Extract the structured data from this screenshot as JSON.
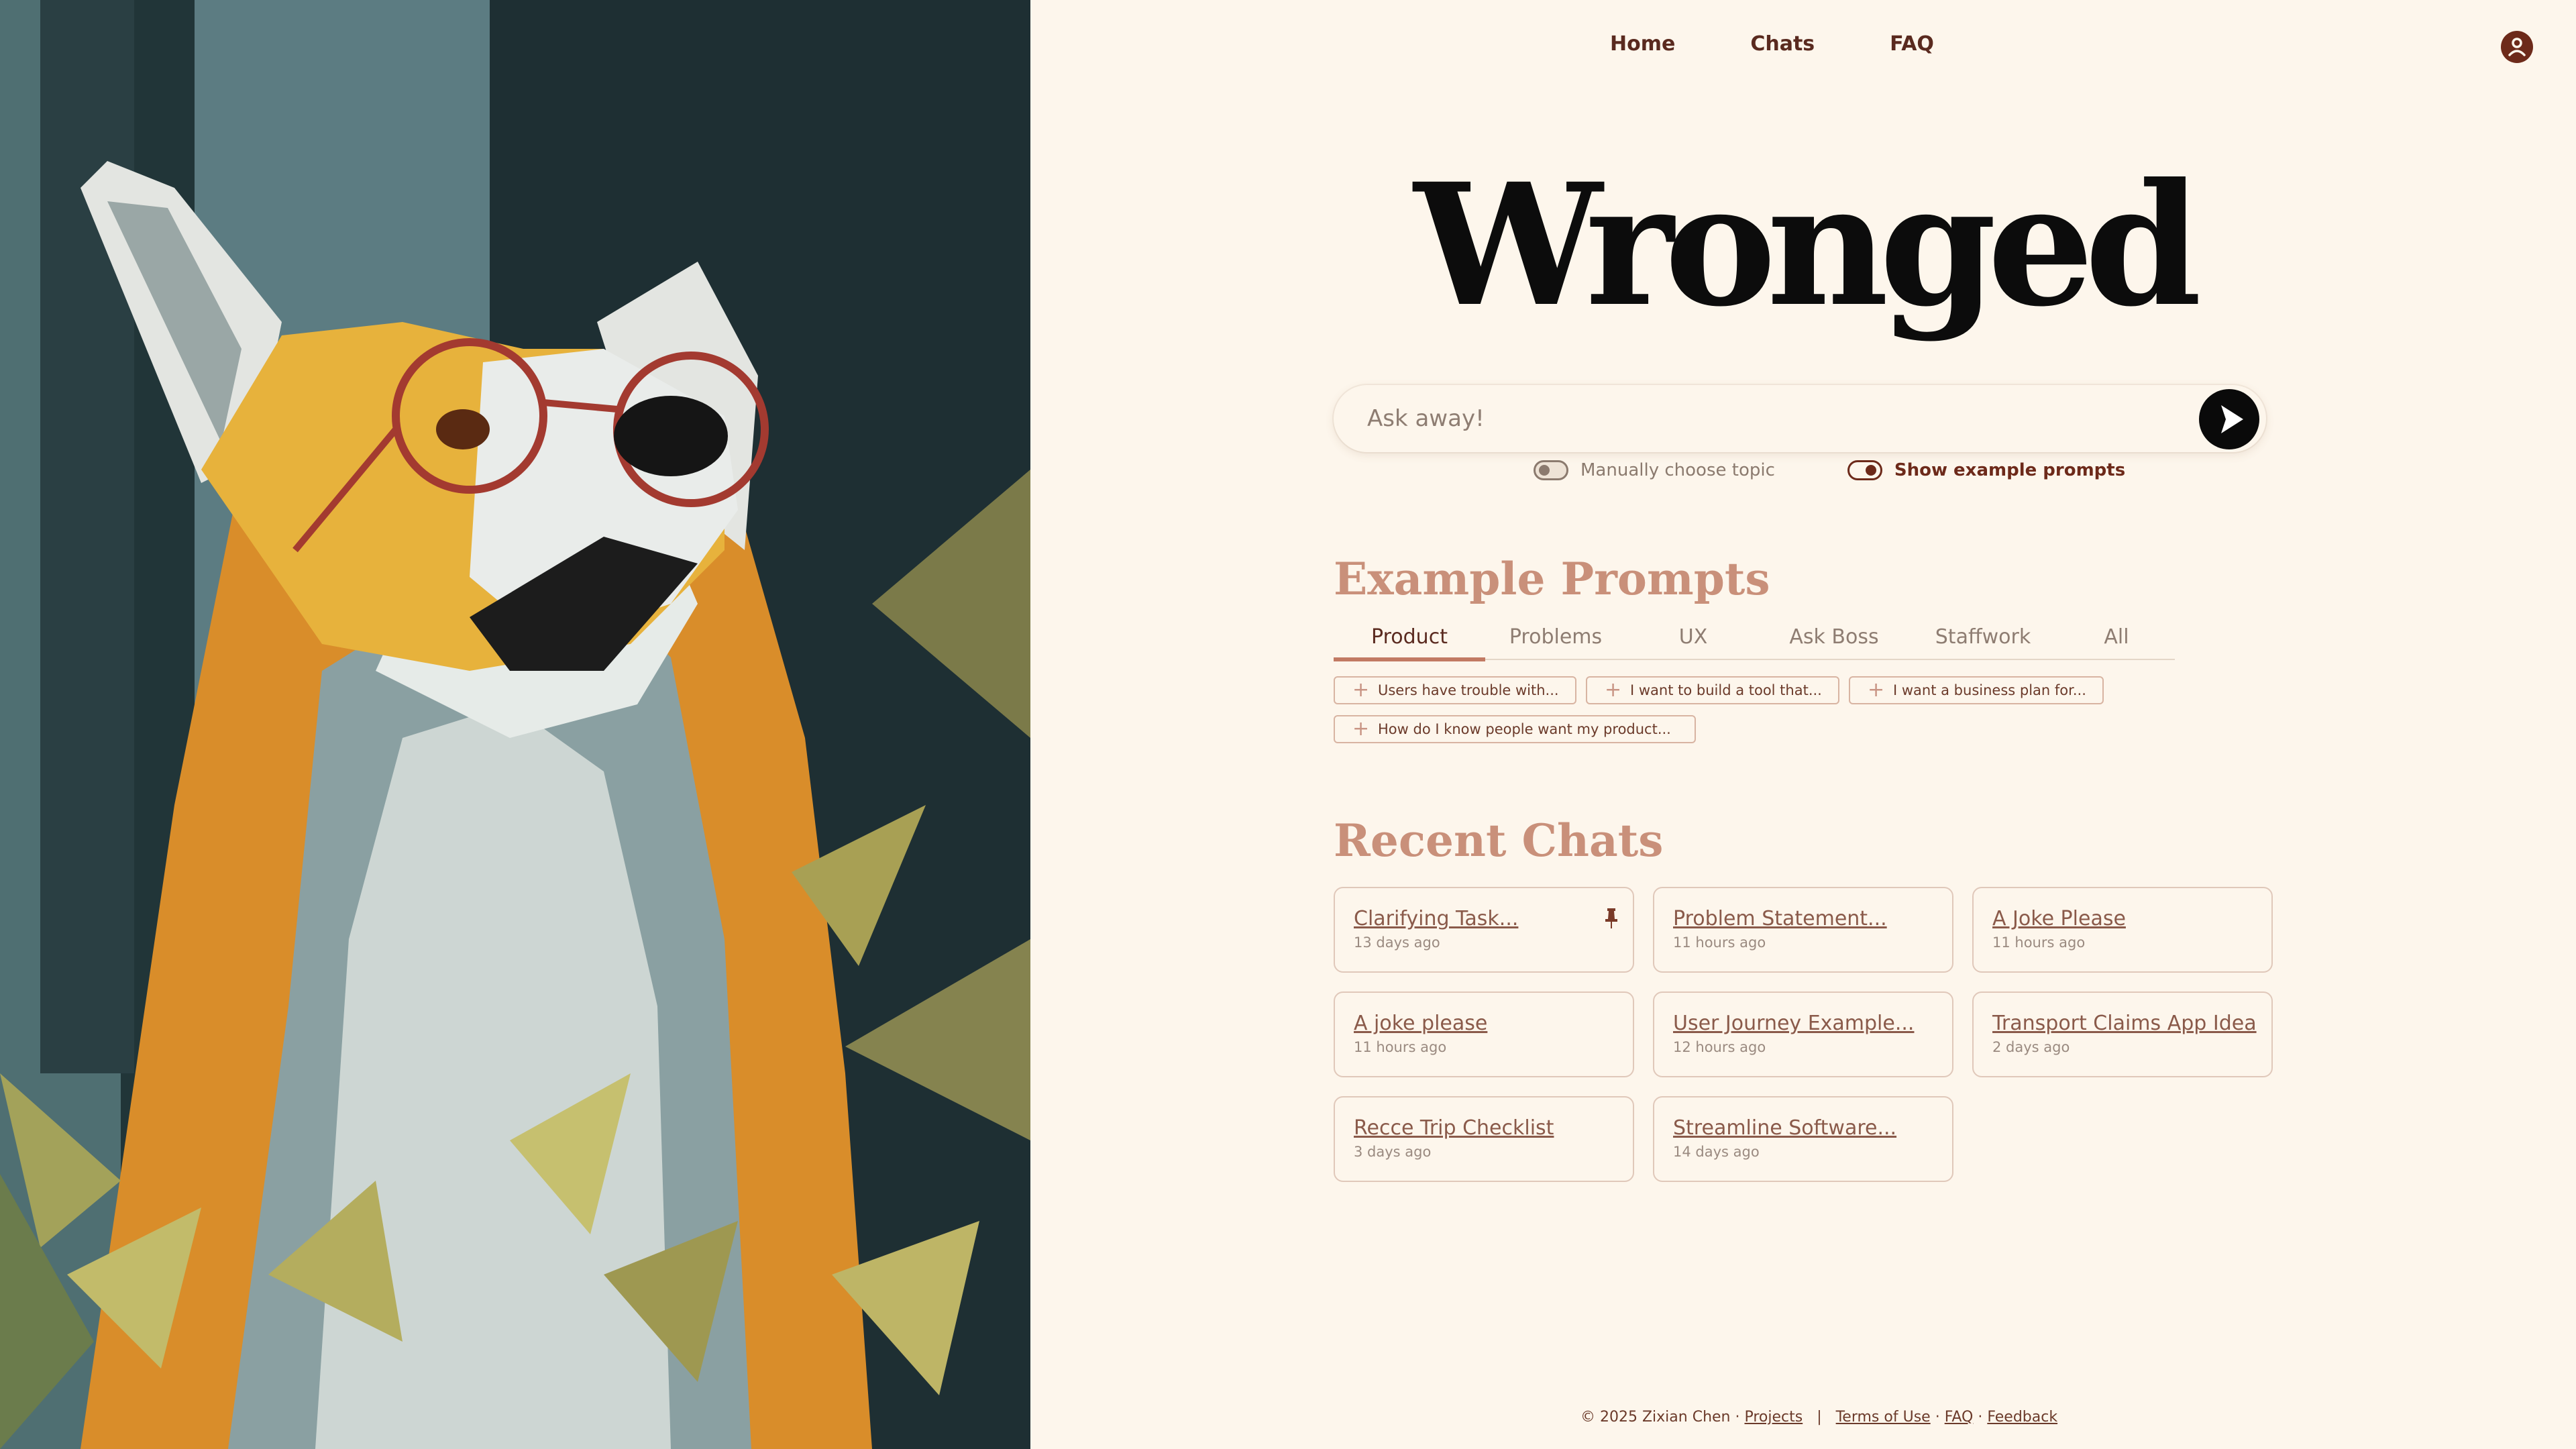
{
  "nav": {
    "items": [
      {
        "label": "Home"
      },
      {
        "label": "Chats"
      },
      {
        "label": "FAQ"
      }
    ]
  },
  "brand": {
    "title": "Wronged"
  },
  "search": {
    "placeholder": "Ask away!",
    "value": ""
  },
  "toggles": {
    "manual_topic": {
      "label": "Manually choose topic",
      "on": false
    },
    "show_examples": {
      "label": "Show example prompts",
      "on": true
    }
  },
  "example_prompts": {
    "heading": "Example Prompts",
    "tabs": [
      {
        "label": "Product",
        "active": true
      },
      {
        "label": "Problems",
        "active": false
      },
      {
        "label": "UX",
        "active": false
      },
      {
        "label": "Ask Boss",
        "active": false
      },
      {
        "label": "Staffwork",
        "active": false
      },
      {
        "label": "All",
        "active": false
      }
    ],
    "chips": [
      {
        "label": "Users have trouble with..."
      },
      {
        "label": "I want to build a tool that..."
      },
      {
        "label": "I want a business plan for..."
      },
      {
        "label": "How do I know people want my product..."
      }
    ]
  },
  "recent_chats": {
    "heading": "Recent Chats",
    "items": [
      {
        "title": "Clarifying Task...",
        "time": "13 days ago",
        "pinned": true
      },
      {
        "title": "Problem Statement...",
        "time": "11 hours ago",
        "pinned": false
      },
      {
        "title": "A Joke Please",
        "time": "11 hours ago",
        "pinned": false
      },
      {
        "title": "A joke please",
        "time": "11 hours ago",
        "pinned": false
      },
      {
        "title": "User Journey Example...",
        "time": "12 hours ago",
        "pinned": false
      },
      {
        "title": "Transport Claims App Idea",
        "time": "2 days ago",
        "pinned": false
      },
      {
        "title": "Recce Trip Checklist",
        "time": "3 days ago",
        "pinned": false
      },
      {
        "title": "Streamline Software...",
        "time": "14 days ago",
        "pinned": false
      }
    ]
  },
  "footer": {
    "copyright": "© 2025 Zixian Chen ·",
    "projects": "Projects",
    "separator": "|",
    "terms": "Terms of Use",
    "dot": "·",
    "faq": "FAQ",
    "feedback": "Feedback"
  },
  "icons": {
    "send": "play-arrow-icon",
    "profile": "user-circle-icon",
    "pin": "pin-icon",
    "chip": "plus-icon"
  },
  "colors": {
    "background": "#fdf6ec",
    "accent": "#6d2a1a",
    "heading_accent": "#c9907a",
    "tab_underline": "#c27a63"
  }
}
